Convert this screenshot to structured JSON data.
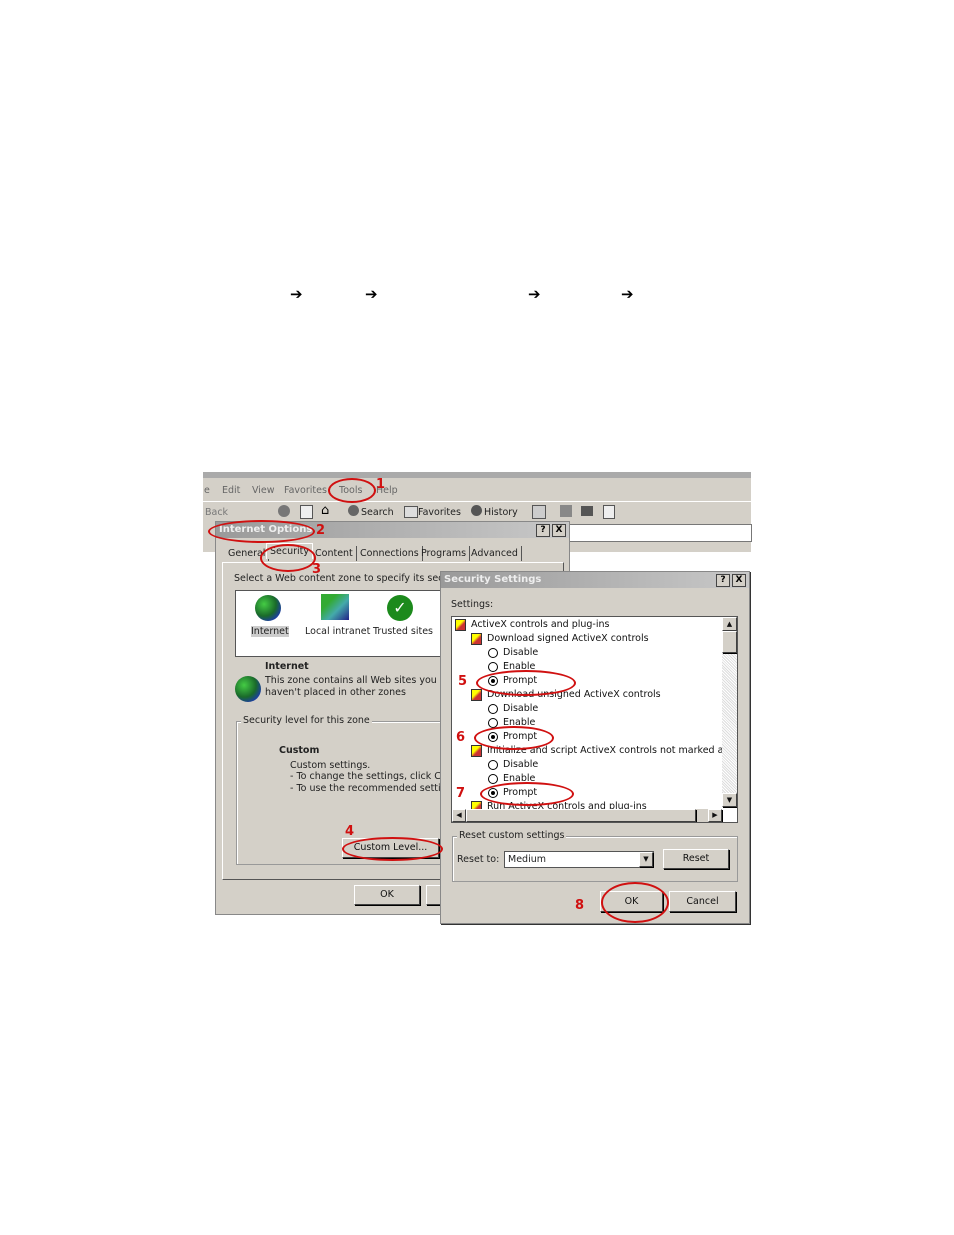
{
  "arrows": [
    "➔",
    "➔",
    "➔",
    "➔"
  ],
  "browser": {
    "menu": [
      "e",
      "Edit",
      "View",
      "Favorites",
      "Tools",
      "Help"
    ],
    "toolbar": {
      "back": "Back",
      "search": "Search",
      "favorites": "Favorites",
      "history": "History"
    }
  },
  "internet_options": {
    "title": "Internet Options",
    "help": "?",
    "close": "X",
    "tabs": [
      "General",
      "Security",
      "Content",
      "Connections",
      "Programs",
      "Advanced"
    ],
    "active_tab": "Security",
    "prompt": "Select a Web content zone to specify its security",
    "zones": [
      "Internet",
      "Local intranet",
      "Trusted sites"
    ],
    "zone_title": "Internet",
    "zone_desc": [
      "This zone contains all Web sites you",
      "haven't placed in other zones"
    ],
    "level_group": "Security level for this zone",
    "level_name": "Custom",
    "level_lines": [
      "Custom settings.",
      "- To change the settings, click Custom Level.",
      "- To use the recommended settings, click Default Level."
    ],
    "custom_level": "Custom Level...",
    "ok": "OK"
  },
  "security_settings": {
    "title": "Security Settings",
    "help": "?",
    "close": "X",
    "settings_label": "Settings:",
    "items": [
      {
        "type": "header",
        "label": "ActiveX controls and plug-ins"
      },
      {
        "type": "setting",
        "label": "Download signed ActiveX controls"
      },
      {
        "type": "radio",
        "label": "Disable",
        "selected": false
      },
      {
        "type": "radio",
        "label": "Enable",
        "selected": false
      },
      {
        "type": "radio",
        "label": "Prompt",
        "selected": true
      },
      {
        "type": "setting",
        "label": "Download unsigned ActiveX controls"
      },
      {
        "type": "radio",
        "label": "Disable",
        "selected": false
      },
      {
        "type": "radio",
        "label": "Enable",
        "selected": false
      },
      {
        "type": "radio",
        "label": "Prompt",
        "selected": true
      },
      {
        "type": "setting",
        "label": "Initialize and script ActiveX controls not marked as safe"
      },
      {
        "type": "radio",
        "label": "Disable",
        "selected": false
      },
      {
        "type": "radio",
        "label": "Enable",
        "selected": false
      },
      {
        "type": "radio",
        "label": "Prompt",
        "selected": true
      },
      {
        "type": "setting",
        "label": "Run ActiveX controls and plug-ins"
      }
    ],
    "reset_group": "Reset custom settings",
    "reset_to_label": "Reset to:",
    "reset_to_value": "Medium",
    "reset_button": "Reset",
    "ok": "OK",
    "cancel": "Cancel"
  },
  "step_numbers": [
    "1",
    "2",
    "3",
    "4",
    "5",
    "6",
    "7",
    "8"
  ],
  "colors": {
    "annotation": "#d01010",
    "dialog": "#d4d0c8"
  }
}
